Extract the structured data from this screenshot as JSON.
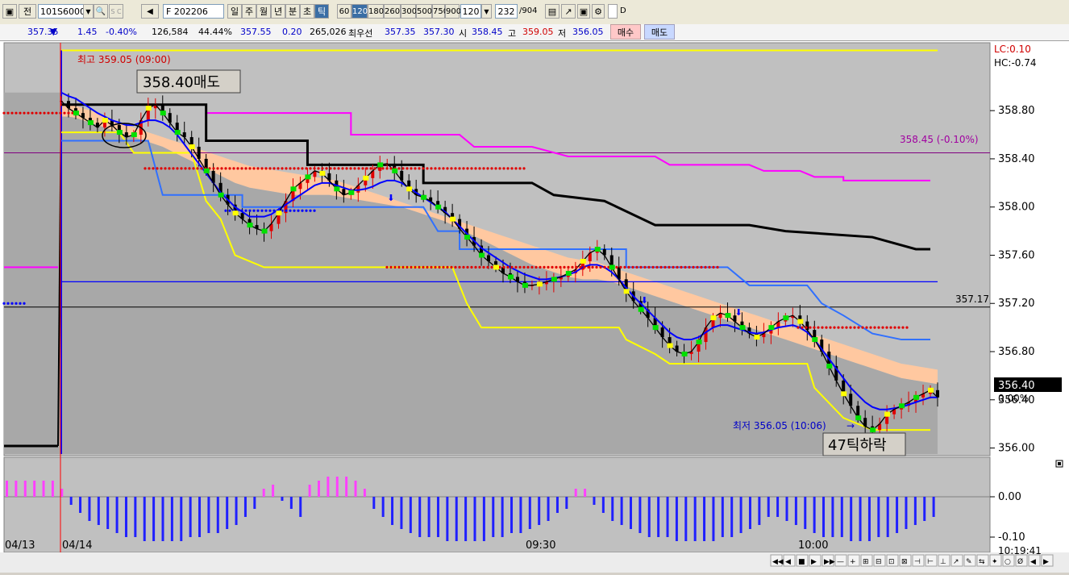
{
  "toolbar": {
    "icon1": "▣",
    "btn_prev": "전",
    "code": "101S6000",
    "code_arrow": "▼",
    "search_icon": "🔍",
    "sc_label": "S C",
    "sound_icon": "◀",
    "futures_label": "F  202206",
    "periods": [
      "일",
      "주",
      "월",
      "년",
      "분",
      "초",
      "틱"
    ],
    "active_period": "틱",
    "ticks": [
      "60",
      "120",
      "180",
      "260",
      "300",
      "500",
      "750",
      "900"
    ],
    "active_tick": "120",
    "tick_value": "120",
    "count": "232",
    "count_total": "/904",
    "d_label": "D"
  },
  "quote": {
    "price": "357.35",
    "arrow": "▼",
    "change": "1.45",
    "pct": "-0.40%",
    "volume": "126,584",
    "vol_ratio": "44.44%",
    "v1": "357.55",
    "v2": "0.20",
    "v3": "265,026",
    "best_label": "최우선",
    "best_bid": "357.35",
    "best_ask": "357.30",
    "open_label": "시",
    "open": "358.45",
    "high_label": "고",
    "high": "359.05",
    "low_label": "저",
    "low": "356.05",
    "buy": "매수",
    "sell": "매도"
  },
  "colors": {
    "panel_bg": "#c0c0c0",
    "up": "#e00000",
    "down": "#000000",
    "ema_blue": "#0000ff",
    "cloud": "#ffc8a0",
    "cloud_gray": "#a8a8a8",
    "magenta": "#ff00ff",
    "yellow": "#ffff00",
    "hist_pos": "#ff40ff",
    "hist_neg": "#2020ff"
  },
  "chart_data": {
    "type": "line",
    "title": "",
    "yaxis": [
      "358.80",
      "358.40",
      "358.00",
      "357.60",
      "357.20",
      "356.80",
      "356.40",
      "356.00"
    ],
    "ylim": [
      355.95,
      359.35
    ],
    "lc_label": "LC:0.10",
    "hc_label": "HC:-0.74",
    "current_price": "356.40",
    "current_pct": "0.00%",
    "hline_label": "357.17",
    "hline_value": 357.17,
    "purple_label": "358.45 (-0.10%)",
    "purple_value": 358.45,
    "high_annotation": "최고 359.05 (09:00)",
    "low_annotation": "최저 356.05 (10:06)",
    "sell_box": "358.40매도",
    "drop_box": "47틱하락",
    "xaxis": [
      "04/13",
      "04/14",
      "09:30",
      "10:00"
    ],
    "time_label": "10:19:41",
    "osc_axis": [
      "0.00",
      "-0.10"
    ],
    "osc_ylim": [
      -0.13,
      0.09
    ],
    "price_series": [
      358.88,
      358.82,
      358.78,
      358.74,
      358.7,
      358.66,
      358.72,
      358.68,
      358.62,
      358.58,
      358.6,
      358.72,
      358.82,
      358.85,
      358.78,
      358.7,
      358.62,
      358.58,
      358.5,
      358.4,
      358.3,
      358.2,
      358.1,
      358.02,
      357.95,
      357.9,
      357.85,
      357.82,
      357.8,
      357.86,
      357.95,
      358.05,
      358.15,
      358.2,
      358.25,
      358.3,
      358.28,
      358.22,
      358.15,
      358.1,
      358.12,
      358.18,
      358.24,
      358.3,
      358.35,
      358.36,
      358.3,
      358.22,
      358.15,
      358.1,
      358.08,
      358.05,
      358.0,
      357.95,
      357.9,
      357.82,
      357.75,
      357.68,
      357.6,
      357.55,
      357.5,
      357.45,
      357.42,
      357.38,
      357.35,
      357.35,
      357.36,
      357.38,
      357.4,
      357.42,
      357.45,
      357.48,
      357.55,
      357.62,
      357.65,
      357.6,
      357.5,
      357.4,
      357.3,
      357.22,
      357.15,
      357.08,
      357.0,
      356.92,
      356.85,
      356.8,
      356.78,
      356.8,
      356.88,
      357.0,
      357.08,
      357.12,
      357.1,
      357.05,
      357.0,
      356.95,
      356.92,
      356.95,
      357.0,
      357.05,
      357.08,
      357.1,
      357.05,
      356.98,
      356.9,
      356.8,
      356.68,
      356.56,
      356.45,
      356.35,
      356.25,
      356.18,
      356.15,
      356.2,
      356.28,
      356.32,
      356.35,
      356.38,
      356.42,
      356.45,
      356.48,
      356.42
    ],
    "ema_series": [
      358.95,
      358.92,
      358.9,
      358.86,
      358.82,
      358.78,
      358.75,
      358.72,
      358.7,
      358.68,
      358.68,
      358.7,
      358.72,
      358.72,
      358.7,
      358.66,
      358.6,
      358.52,
      358.44,
      358.36,
      358.28,
      358.2,
      358.12,
      358.06,
      358.0,
      357.96,
      357.92,
      357.92,
      357.92,
      357.94,
      357.98,
      358.02,
      358.06,
      358.1,
      358.14,
      358.18,
      358.2,
      358.2,
      358.18,
      358.16,
      358.14,
      358.14,
      358.15,
      358.17,
      358.2,
      358.22,
      358.22,
      358.2,
      358.16,
      358.12,
      358.08,
      358.04,
      358.0,
      357.96,
      357.9,
      357.84,
      357.78,
      357.72,
      357.66,
      357.62,
      357.58,
      357.54,
      357.5,
      357.47,
      357.44,
      357.42,
      357.4,
      357.4,
      357.41,
      357.42,
      357.44,
      357.46,
      357.5,
      357.52,
      357.52,
      357.5,
      357.46,
      357.4,
      357.33,
      357.26,
      357.2,
      357.14,
      357.08,
      357.02,
      356.96,
      356.92,
      356.9,
      356.9,
      356.92,
      356.96,
      357.0,
      357.02,
      357.02,
      357.0,
      356.98,
      356.96,
      356.95,
      356.96,
      356.98,
      357.0,
      357.01,
      357.02,
      357.0,
      356.96,
      356.9,
      356.82,
      356.74,
      356.66,
      356.58,
      356.5,
      356.44,
      356.38,
      356.34,
      356.32,
      356.32,
      356.33,
      356.34,
      356.36,
      356.38,
      356.4,
      356.42,
      356.42
    ],
    "cloud_top": [
      358.85,
      358.85,
      358.84,
      358.82,
      358.8,
      358.78,
      358.75,
      358.73,
      358.7,
      358.68,
      358.66,
      358.64,
      358.62,
      358.6,
      358.58,
      358.56,
      358.54,
      358.52,
      358.5,
      358.48,
      358.46,
      358.44,
      358.42,
      358.4,
      358.38,
      358.36,
      358.34,
      358.33,
      358.32,
      358.31,
      358.3,
      358.29,
      358.28,
      358.27,
      358.26,
      358.25,
      358.24,
      358.23,
      358.22,
      358.2,
      358.18,
      358.16,
      358.14,
      358.12,
      358.1,
      358.08,
      358.06,
      358.04,
      358.02,
      358.0,
      357.98,
      357.96,
      357.94,
      357.92,
      357.9,
      357.88,
      357.86,
      357.84,
      357.82,
      357.8,
      357.78,
      357.76,
      357.74,
      357.72,
      357.7,
      357.68,
      357.66,
      357.64,
      357.62,
      357.6,
      357.58,
      357.57,
      357.56,
      357.55,
      357.54,
      357.52,
      357.5,
      357.48,
      357.46,
      357.44,
      357.42,
      357.4,
      357.38,
      357.36,
      357.34,
      357.32,
      357.3,
      357.28,
      357.26,
      357.24,
      357.22,
      357.2,
      357.18,
      357.16,
      357.14,
      357.12,
      357.1,
      357.08,
      357.06,
      357.04,
      357.02,
      357.0,
      356.98,
      356.96,
      356.94,
      356.92,
      356.9,
      356.88,
      356.86,
      356.84,
      356.82,
      356.8,
      356.78,
      356.76,
      356.74,
      356.72,
      356.7,
      356.69,
      356.68,
      356.67,
      356.66,
      356.65
    ],
    "cloud_bottom": [
      358.75,
      358.75,
      358.74,
      358.72,
      358.7,
      358.68,
      358.66,
      358.64,
      358.62,
      358.6,
      358.58,
      358.56,
      358.54,
      358.52,
      358.5,
      358.47,
      358.44,
      358.41,
      358.38,
      358.35,
      358.32,
      358.29,
      358.26,
      358.23,
      358.2,
      358.18,
      358.16,
      358.15,
      358.14,
      358.13,
      358.12,
      358.11,
      358.1,
      358.1,
      358.1,
      358.1,
      358.1,
      358.1,
      358.09,
      358.08,
      358.07,
      358.06,
      358.05,
      358.04,
      358.03,
      358.02,
      358.01,
      358.0,
      357.98,
      357.96,
      357.94,
      357.92,
      357.9,
      357.88,
      357.85,
      357.82,
      357.79,
      357.76,
      357.73,
      357.7,
      357.67,
      357.64,
      357.61,
      357.58,
      357.55,
      357.52,
      357.5,
      357.48,
      357.46,
      357.44,
      357.42,
      357.41,
      357.4,
      357.4,
      357.4,
      357.39,
      357.38,
      357.36,
      357.34,
      357.32,
      357.3,
      357.28,
      357.26,
      357.24,
      357.22,
      357.2,
      357.18,
      357.16,
      357.14,
      357.12,
      357.1,
      357.08,
      357.06,
      357.04,
      357.02,
      357.0,
      356.98,
      356.96,
      356.94,
      356.92,
      356.9,
      356.88,
      356.86,
      356.84,
      356.82,
      356.8,
      356.78,
      356.76,
      356.74,
      356.72,
      356.7,
      356.68,
      356.66,
      356.64,
      356.62,
      356.6,
      356.58,
      356.57,
      356.56,
      356.55,
      356.54,
      356.53
    ],
    "black_stair": [
      [
        0,
        358.85
      ],
      [
        20,
        358.85
      ],
      [
        20,
        358.55
      ],
      [
        34,
        358.55
      ],
      [
        34,
        358.35
      ],
      [
        50,
        358.35
      ],
      [
        50,
        358.2
      ],
      [
        65,
        358.2
      ],
      [
        68,
        358.1
      ],
      [
        75,
        358.05
      ],
      [
        82,
        357.85
      ],
      [
        95,
        357.85
      ],
      [
        100,
        357.8
      ],
      [
        112,
        357.75
      ],
      [
        118,
        357.65
      ],
      [
        120,
        357.65
      ]
    ],
    "magenta_stair": [
      [
        0,
        358.85
      ],
      [
        20,
        358.85
      ],
      [
        20,
        358.78
      ],
      [
        40,
        358.78
      ],
      [
        40,
        358.6
      ],
      [
        55,
        358.6
      ],
      [
        57,
        358.5
      ],
      [
        65,
        358.5
      ],
      [
        70,
        358.42
      ],
      [
        82,
        358.42
      ],
      [
        84,
        358.35
      ],
      [
        95,
        358.35
      ],
      [
        97,
        358.3
      ],
      [
        102,
        358.3
      ],
      [
        104,
        358.25
      ],
      [
        108,
        358.25
      ],
      [
        108,
        358.22
      ],
      [
        120,
        358.22
      ]
    ],
    "blue_stair": [
      [
        0,
        358.55
      ],
      [
        12,
        358.55
      ],
      [
        14,
        358.1
      ],
      [
        25,
        358.1
      ],
      [
        25,
        358.0
      ],
      [
        50,
        358.0
      ],
      [
        52,
        357.8
      ],
      [
        55,
        357.8
      ],
      [
        55,
        357.65
      ],
      [
        78,
        357.65
      ],
      [
        78,
        357.5
      ],
      [
        92,
        357.5
      ],
      [
        95,
        357.35
      ],
      [
        103,
        357.35
      ],
      [
        105,
        357.2
      ],
      [
        108,
        357.1
      ],
      [
        112,
        356.95
      ],
      [
        116,
        356.9
      ],
      [
        120,
        356.9
      ]
    ],
    "yellow_stair": [
      [
        0,
        358.62
      ],
      [
        8,
        358.62
      ],
      [
        10,
        358.45
      ],
      [
        18,
        358.45
      ],
      [
        20,
        358.05
      ],
      [
        22,
        357.9
      ],
      [
        24,
        357.6
      ],
      [
        28,
        357.5
      ],
      [
        54,
        357.5
      ],
      [
        56,
        357.2
      ],
      [
        58,
        357.0
      ],
      [
        77,
        357.0
      ],
      [
        78,
        356.9
      ],
      [
        82,
        356.78
      ],
      [
        84,
        356.7
      ],
      [
        103,
        356.7
      ],
      [
        104,
        356.5
      ],
      [
        108,
        356.25
      ],
      [
        112,
        356.15
      ],
      [
        120,
        356.15
      ]
    ],
    "osc_values": [
      0.04,
      0.04,
      0.04,
      0.04,
      0.04,
      0.04,
      0.02,
      -0.02,
      -0.04,
      -0.06,
      -0.07,
      -0.08,
      -0.09,
      -0.1,
      -0.1,
      -0.11,
      -0.11,
      -0.11,
      -0.11,
      -0.11,
      -0.1,
      -0.1,
      -0.09,
      -0.09,
      -0.08,
      -0.07,
      -0.05,
      -0.03,
      0.02,
      0.03,
      -0.01,
      -0.03,
      -0.05,
      0.03,
      0.04,
      0.05,
      0.05,
      0.05,
      0.04,
      0.02,
      -0.03,
      -0.05,
      -0.07,
      -0.08,
      -0.09,
      -0.1,
      -0.1,
      -0.1,
      -0.11,
      -0.11,
      -0.11,
      -0.11,
      -0.11,
      -0.1,
      -0.1,
      -0.09,
      -0.09,
      -0.08,
      -0.07,
      -0.06,
      -0.04,
      -0.03,
      0.02,
      0.02,
      -0.02,
      -0.04,
      -0.06,
      -0.07,
      -0.08,
      -0.09,
      -0.1,
      -0.1,
      -0.1,
      -0.11,
      -0.11,
      -0.11,
      -0.11,
      -0.11,
      -0.1,
      -0.1,
      -0.09,
      -0.08,
      -0.07,
      -0.05,
      -0.05,
      -0.06,
      -0.07,
      -0.08,
      -0.09,
      -0.1,
      -0.1,
      -0.1,
      -0.11,
      -0.11,
      -0.11,
      -0.1,
      -0.1,
      -0.09,
      -0.08,
      -0.07,
      -0.06,
      -0.05
    ]
  },
  "nav": {
    "buttons": [
      "◀◀",
      "◀",
      "■",
      "▶",
      "▶▶",
      "—",
      "+",
      "⊞",
      "⊟",
      "⊡",
      "⊠",
      "⊣",
      "⊢",
      "⊥",
      "↗",
      "✎",
      "⇆",
      "✦",
      "○",
      "Ø",
      "◀",
      "▶"
    ]
  }
}
